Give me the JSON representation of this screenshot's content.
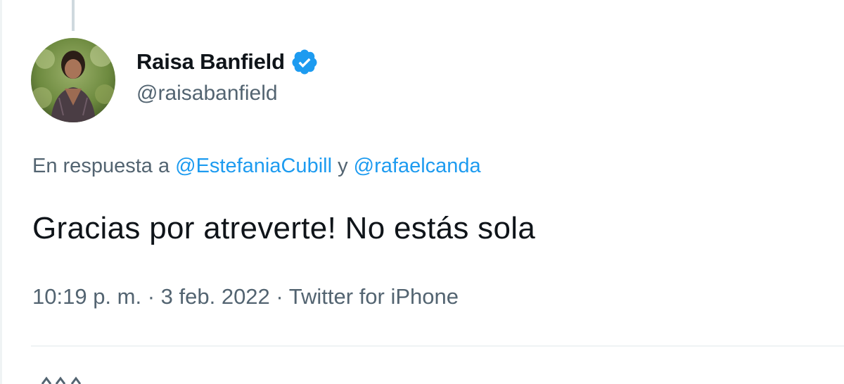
{
  "tweet": {
    "author": {
      "display_name": "Raisa Banfield",
      "handle": "@raisabanfield",
      "verified_icon": "verified-badge-icon",
      "verified_color": "#1d9bf0"
    },
    "reply_context": {
      "prefix": "En respuesta a ",
      "mention_1": "@EstefaniaCubill",
      "joiner": " y ",
      "mention_2": "@rafaelcanda"
    },
    "text": "Gracias por atreverte! No estás sola",
    "meta": {
      "time": "10:19 p. m.",
      "separator": " · ",
      "date": "3 feb. 2022",
      "source": "Twitter for iPhone"
    }
  },
  "colors": {
    "text_primary": "#0f1419",
    "text_secondary": "#536471",
    "accent": "#1d9bf0",
    "divider": "#eff3f4"
  }
}
